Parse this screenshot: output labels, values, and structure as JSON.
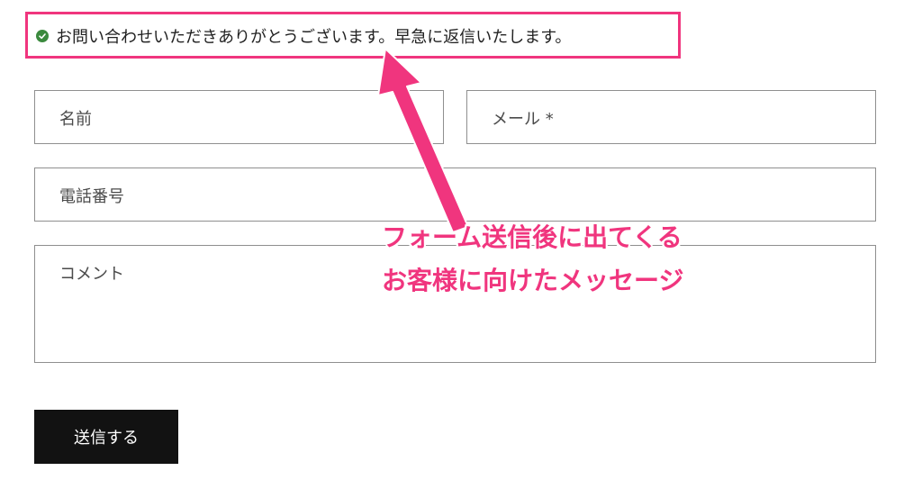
{
  "success": {
    "message": "お問い合わせいただきありがとうございます。早急に返信いたします。"
  },
  "form": {
    "name_placeholder": "名前",
    "email_placeholder": "メール *",
    "phone_placeholder": "電話番号",
    "comment_placeholder": "コメント",
    "submit_label": "送信する"
  },
  "annotation": {
    "line1": "フォーム送信後に出てくる",
    "line2": "お客様に向けたメッセージ"
  },
  "colors": {
    "highlight": "#f0357e",
    "success_icon": "#3b8a3e",
    "button_bg": "#121212"
  },
  "icons": {
    "success": "check-circle-icon"
  }
}
